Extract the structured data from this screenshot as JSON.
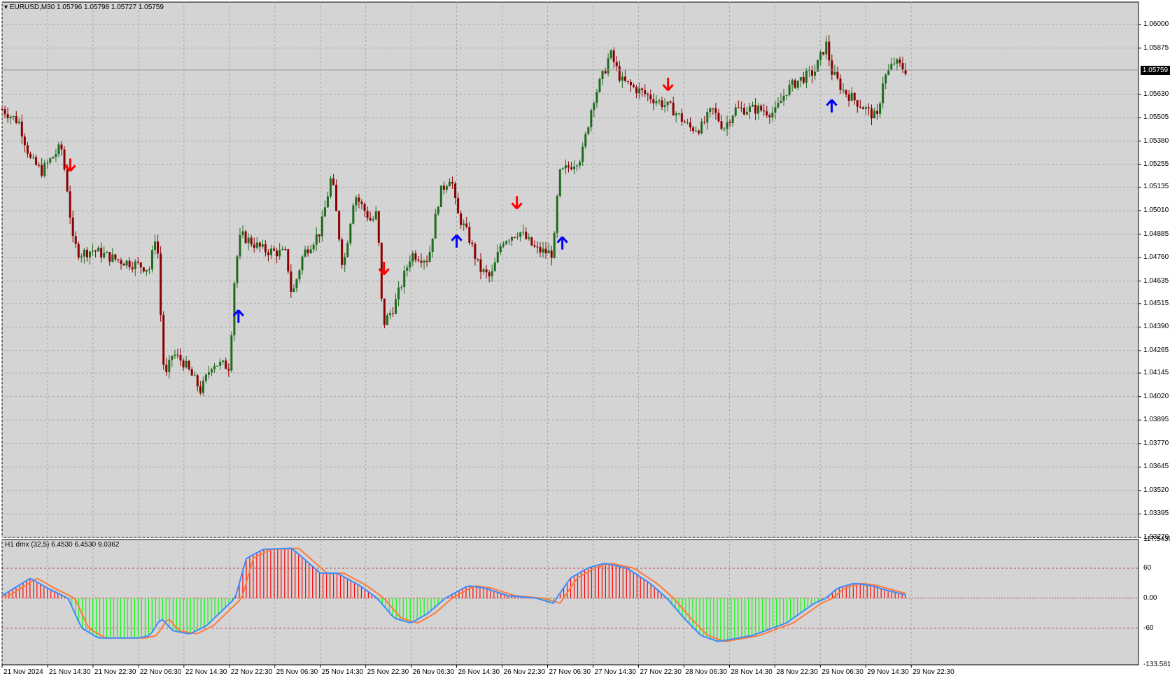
{
  "chart_header": {
    "title": "EURUSD,M30  1.05796 1.05798 1.05727 1.05759",
    "menu_icon": "triangle-down-icon"
  },
  "current_price": "1.05759",
  "price_axis": [
    "1.06000",
    "1.05875",
    "1.05630",
    "1.05505",
    "1.05380",
    "1.05255",
    "1.05135",
    "1.05010",
    "1.04885",
    "1.04760",
    "1.04635",
    "1.04515",
    "1.04390",
    "1.04265",
    "1.04145",
    "1.04020",
    "1.03895",
    "1.03770",
    "1.03645",
    "1.03520",
    "1.03395",
    "1.03270"
  ],
  "time_axis": [
    "21 Nov 2024",
    "21 Nov 14:30",
    "21 Nov 22:30",
    "22 Nov 06:30",
    "22 Nov 14:30",
    "22 Nov 22:30",
    "25 Nov 06:30",
    "25 Nov 14:30",
    "25 Nov 22:30",
    "26 Nov 06:30",
    "26 Nov 14:30",
    "26 Nov 22:30",
    "27 Nov 06:30",
    "27 Nov 14:30",
    "27 Nov 22:30",
    "28 Nov 06:30",
    "28 Nov 14:30",
    "28 Nov 22:30",
    "29 Nov 06:30",
    "29 Nov 14:30",
    "29 Nov 22:30"
  ],
  "indicator": {
    "header": "H1 dmx (32,5) 6.4530 6.4530 9.0362",
    "levels": [
      "117.5436",
      "60",
      "0.00",
      "-60",
      "-133.581"
    ]
  },
  "colors": {
    "background": "#d4d4d4",
    "grid": "#a8a8a8",
    "bull": "#1d6b1d",
    "bear": "#8b0000",
    "sell_arrow": "#ff0000",
    "buy_arrow": "#0000ff",
    "hist_up": "#ff0000",
    "hist_down": "#00ff00",
    "line_fast": "#3a8cff",
    "line_slow": "#ff7a3c"
  },
  "chart_data": {
    "type": "candlestick",
    "symbol": "EURUSD",
    "timeframe": "M30",
    "ylim": [
      1.0327,
      1.0612
    ],
    "x_range": [
      "21 Nov 2024",
      "29 Nov 22:30"
    ],
    "grid": true,
    "path_points": [
      {
        "t": 0.0,
        "p": 1.0555
      },
      {
        "t": 0.015,
        "p": 1.0548
      },
      {
        "t": 0.025,
        "p": 1.0528
      },
      {
        "t": 0.035,
        "p": 1.0522
      },
      {
        "t": 0.045,
        "p": 1.053
      },
      {
        "t": 0.052,
        "p": 1.0535
      },
      {
        "t": 0.058,
        "p": 1.051
      },
      {
        "t": 0.062,
        "p": 1.0485
      },
      {
        "t": 0.068,
        "p": 1.0478
      },
      {
        "t": 0.08,
        "p": 1.048
      },
      {
        "t": 0.1,
        "p": 1.0475
      },
      {
        "t": 0.12,
        "p": 1.0472
      },
      {
        "t": 0.13,
        "p": 1.047
      },
      {
        "t": 0.136,
        "p": 1.0492
      },
      {
        "t": 0.14,
        "p": 1.044
      },
      {
        "t": 0.143,
        "p": 1.041
      },
      {
        "t": 0.15,
        "p": 1.0425
      },
      {
        "t": 0.16,
        "p": 1.042
      },
      {
        "t": 0.175,
        "p": 1.0405
      },
      {
        "t": 0.185,
        "p": 1.042
      },
      {
        "t": 0.2,
        "p": 1.0418
      },
      {
        "t": 0.205,
        "p": 1.047
      },
      {
        "t": 0.21,
        "p": 1.0488
      },
      {
        "t": 0.23,
        "p": 1.048
      },
      {
        "t": 0.25,
        "p": 1.0478
      },
      {
        "t": 0.255,
        "p": 1.0455
      },
      {
        "t": 0.265,
        "p": 1.0478
      },
      {
        "t": 0.28,
        "p": 1.049
      },
      {
        "t": 0.29,
        "p": 1.052
      },
      {
        "t": 0.3,
        "p": 1.047
      },
      {
        "t": 0.31,
        "p": 1.051
      },
      {
        "t": 0.325,
        "p": 1.0495
      },
      {
        "t": 0.33,
        "p": 1.05
      },
      {
        "t": 0.335,
        "p": 1.044
      },
      {
        "t": 0.345,
        "p": 1.045
      },
      {
        "t": 0.36,
        "p": 1.0478
      },
      {
        "t": 0.375,
        "p": 1.0475
      },
      {
        "t": 0.385,
        "p": 1.051
      },
      {
        "t": 0.395,
        "p": 1.052
      },
      {
        "t": 0.4,
        "p": 1.05
      },
      {
        "t": 0.41,
        "p": 1.0488
      },
      {
        "t": 0.42,
        "p": 1.047
      },
      {
        "t": 0.43,
        "p": 1.0465
      },
      {
        "t": 0.44,
        "p": 1.0485
      },
      {
        "t": 0.455,
        "p": 1.049
      },
      {
        "t": 0.47,
        "p": 1.048
      },
      {
        "t": 0.485,
        "p": 1.0478
      },
      {
        "t": 0.49,
        "p": 1.052
      },
      {
        "t": 0.5,
        "p": 1.0525
      },
      {
        "t": 0.51,
        "p": 1.053
      },
      {
        "t": 0.52,
        "p": 1.056
      },
      {
        "t": 0.53,
        "p": 1.0575
      },
      {
        "t": 0.535,
        "p": 1.0585
      },
      {
        "t": 0.545,
        "p": 1.057
      },
      {
        "t": 0.56,
        "p": 1.0565
      },
      {
        "t": 0.575,
        "p": 1.056
      },
      {
        "t": 0.59,
        "p": 1.0555
      },
      {
        "t": 0.605,
        "p": 1.0545
      },
      {
        "t": 0.615,
        "p": 1.0545
      },
      {
        "t": 0.625,
        "p": 1.0555
      },
      {
        "t": 0.635,
        "p": 1.0545
      },
      {
        "t": 0.645,
        "p": 1.0555
      },
      {
        "t": 0.665,
        "p": 1.0555
      },
      {
        "t": 0.68,
        "p": 1.0553
      },
      {
        "t": 0.69,
        "p": 1.0565
      },
      {
        "t": 0.7,
        "p": 1.057
      },
      {
        "t": 0.715,
        "p": 1.0575
      },
      {
        "t": 0.725,
        "p": 1.059
      },
      {
        "t": 0.73,
        "p": 1.0575
      },
      {
        "t": 0.74,
        "p": 1.0565
      },
      {
        "t": 0.75,
        "p": 1.056
      },
      {
        "t": 0.76,
        "p": 1.0555
      },
      {
        "t": 0.77,
        "p": 1.055
      },
      {
        "t": 0.775,
        "p": 1.057
      },
      {
        "t": 0.785,
        "p": 1.058
      },
      {
        "t": 0.795,
        "p": 1.05759
      }
    ],
    "signals": [
      {
        "type": "sell",
        "t": 0.06,
        "p": 1.0525
      },
      {
        "type": "buy",
        "t": 0.208,
        "p": 1.0445
      },
      {
        "type": "sell",
        "t": 0.336,
        "p": 1.047
      },
      {
        "type": "buy",
        "t": 0.4,
        "p": 1.0485
      },
      {
        "type": "sell",
        "t": 0.453,
        "p": 1.0505
      },
      {
        "type": "buy",
        "t": 0.493,
        "p": 1.0484
      },
      {
        "type": "sell",
        "t": 0.586,
        "p": 1.0568
      },
      {
        "type": "buy",
        "t": 0.73,
        "p": 1.0557
      }
    ],
    "indicator_series": [
      {
        "t": 0.0,
        "v": 5
      },
      {
        "t": 0.025,
        "v": 40
      },
      {
        "t": 0.04,
        "v": 20
      },
      {
        "t": 0.058,
        "v": 0
      },
      {
        "t": 0.07,
        "v": -60
      },
      {
        "t": 0.085,
        "v": -80
      },
      {
        "t": 0.12,
        "v": -80
      },
      {
        "t": 0.13,
        "v": -75
      },
      {
        "t": 0.14,
        "v": -40
      },
      {
        "t": 0.15,
        "v": -65
      },
      {
        "t": 0.165,
        "v": -72
      },
      {
        "t": 0.18,
        "v": -55
      },
      {
        "t": 0.205,
        "v": 0
      },
      {
        "t": 0.215,
        "v": 80
      },
      {
        "t": 0.23,
        "v": 98
      },
      {
        "t": 0.255,
        "v": 100
      },
      {
        "t": 0.265,
        "v": 80
      },
      {
        "t": 0.28,
        "v": 50
      },
      {
        "t": 0.295,
        "v": 50
      },
      {
        "t": 0.315,
        "v": 25
      },
      {
        "t": 0.33,
        "v": 0
      },
      {
        "t": 0.345,
        "v": -40
      },
      {
        "t": 0.36,
        "v": -50
      },
      {
        "t": 0.375,
        "v": -30
      },
      {
        "t": 0.39,
        "v": 0
      },
      {
        "t": 0.41,
        "v": 25
      },
      {
        "t": 0.425,
        "v": 20
      },
      {
        "t": 0.445,
        "v": 5
      },
      {
        "t": 0.47,
        "v": 0
      },
      {
        "t": 0.485,
        "v": -10
      },
      {
        "t": 0.5,
        "v": 40
      },
      {
        "t": 0.515,
        "v": 60
      },
      {
        "t": 0.53,
        "v": 70
      },
      {
        "t": 0.55,
        "v": 60
      },
      {
        "t": 0.57,
        "v": 30
      },
      {
        "t": 0.585,
        "v": 0
      },
      {
        "t": 0.6,
        "v": -40
      },
      {
        "t": 0.615,
        "v": -75
      },
      {
        "t": 0.63,
        "v": -87
      },
      {
        "t": 0.66,
        "v": -75
      },
      {
        "t": 0.69,
        "v": -50
      },
      {
        "t": 0.715,
        "v": -10
      },
      {
        "t": 0.725,
        "v": 0
      },
      {
        "t": 0.735,
        "v": 20
      },
      {
        "t": 0.75,
        "v": 30
      },
      {
        "t": 0.765,
        "v": 25
      },
      {
        "t": 0.78,
        "v": 15
      },
      {
        "t": 0.795,
        "v": 6.45
      }
    ]
  }
}
